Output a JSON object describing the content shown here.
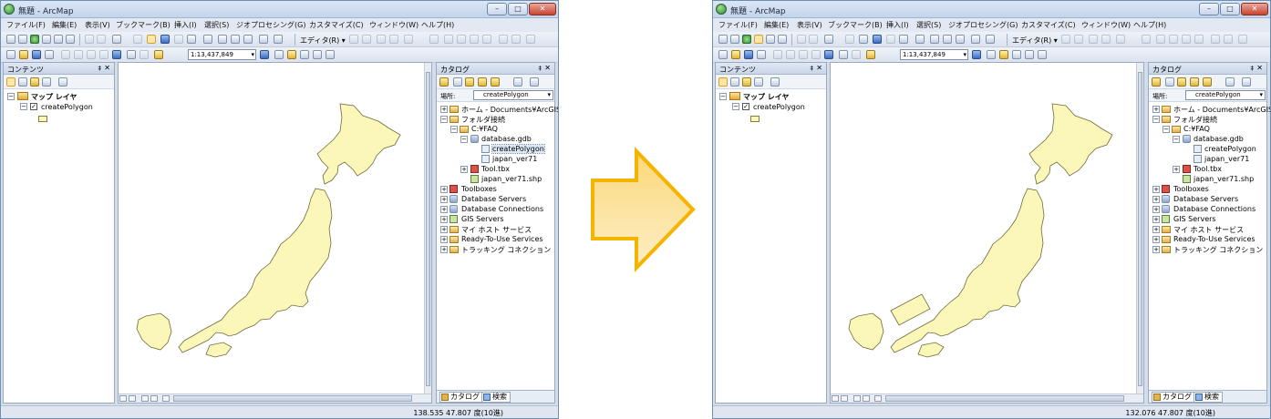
{
  "window_title": "無題 - ArcMap",
  "title_buttons": {
    "min": "–",
    "max": "□",
    "close": "✕"
  },
  "menu": [
    "ファイル(F)",
    "編集(E)",
    "表示(V)",
    "ブックマーク(B)",
    "挿入(I)",
    "選択(S)",
    "ジオプロセシング(G)",
    "カスタマイズ(C)",
    "ウィンドウ(W)",
    "ヘルプ(H)"
  ],
  "toolbar": {
    "editor_label": "エディタ(R) ▾",
    "scale_value": "1:13,437,849",
    "scale_dropdown": "▾"
  },
  "contents": {
    "title": "コンテンツ",
    "pin": "‡",
    "close": "✕",
    "map_layer": "マップ レイヤ",
    "layer_name": "createPolygon",
    "expand_minus": "−",
    "check_mark": "✓"
  },
  "catalog": {
    "title": "カタログ",
    "pin": "‡",
    "close": "✕",
    "location_label": "場所:",
    "location_value": "createPolygon",
    "location_dropdown": "▾",
    "tree": [
      "ホーム - Documents¥ArcGIS",
      "フォルダ接続",
      "C:¥FAQ",
      "database.gdb",
      "createPolygon",
      "japan_ver71",
      "Tool.tbx",
      "japan_ver71.shp",
      "Toolboxes",
      "Database Servers",
      "Database Connections",
      "GIS Servers",
      "マイ ホスト サービス",
      "Ready-To-Use Services",
      "トラッキング コネクション"
    ],
    "tab_catalog": "カタログ",
    "tab_search": "検索",
    "plus": "+",
    "minus": "−"
  },
  "status": {
    "left_window": "138.535  47.807 度(10進)",
    "right_window": "132.076  47.807 度(10進)"
  },
  "colors": {
    "map_fill": "#fbf7b9",
    "map_stroke": "#6e6a3c",
    "arrow_fill_top": "#fdd87a",
    "arrow_fill_bottom": "#fbe9b3",
    "arrow_stroke": "#f5b400"
  },
  "icons": [
    "search-icon",
    "zoom-in-icon",
    "zoom-out-icon",
    "globe-icon",
    "pan-icon",
    "full-extent-icon",
    "select-arrow-icon",
    "identify-icon",
    "folder-icon",
    "database-icon",
    "toolbox-icon",
    "shapefile-icon"
  ]
}
